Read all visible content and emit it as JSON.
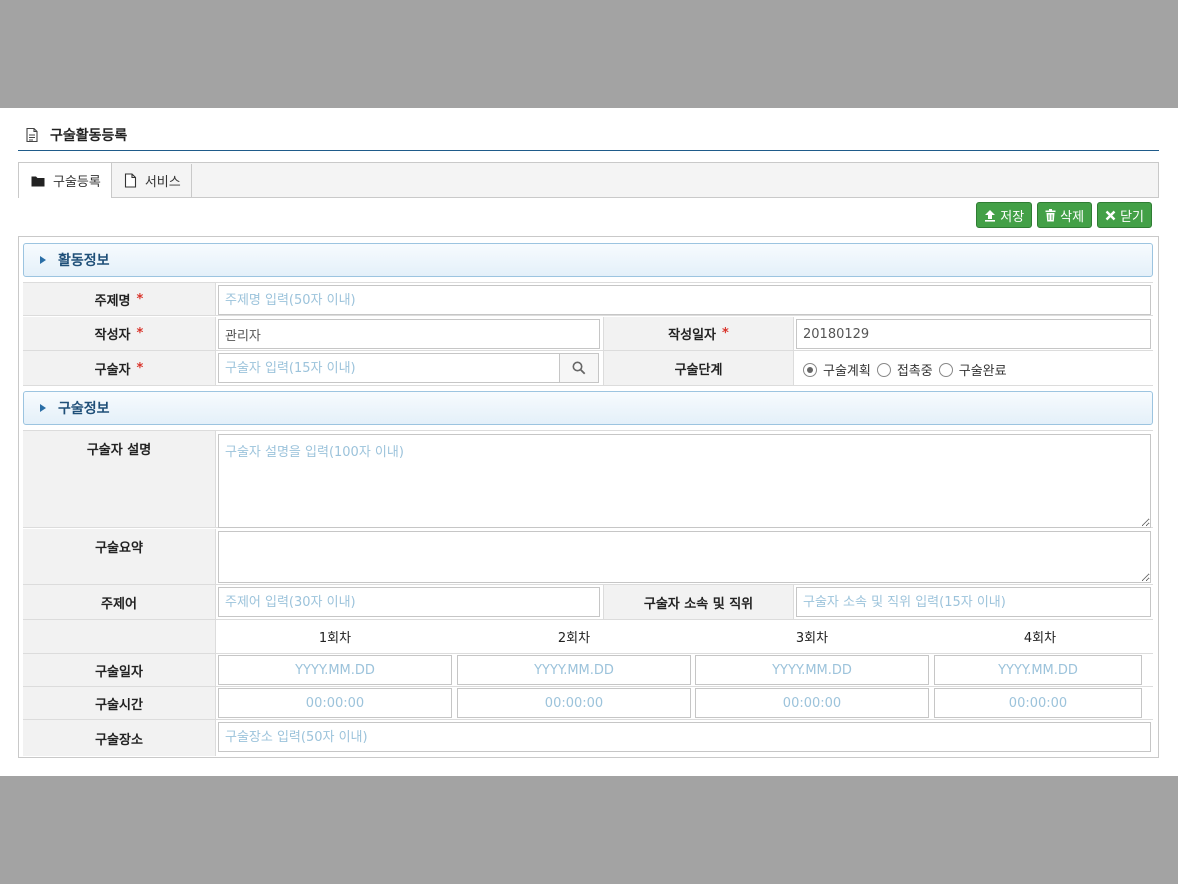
{
  "page": {
    "title": "구술활동등록"
  },
  "tabs": [
    {
      "label": "구술등록",
      "icon": "folder-icon",
      "active": true
    },
    {
      "label": "서비스",
      "icon": "document-icon",
      "active": false
    }
  ],
  "toolbar": {
    "save_label": "저장",
    "delete_label": "삭제",
    "close_label": "닫기",
    "button_color": "#43a047"
  },
  "activity_section": {
    "title": "활동정보",
    "subject_label": "주제명",
    "subject_placeholder": "주제명 입력(50자 이내)",
    "author_label": "작성자",
    "author_value": "관리자",
    "date_label": "작성일자",
    "date_value": "20180129",
    "narrator_label": "구술자",
    "narrator_placeholder": "구술자 입력(15자 이내)",
    "stage_label": "구술단계",
    "stage_options": [
      "구술계획",
      "접촉중",
      "구술완료"
    ],
    "stage_selected": "구술계획",
    "required_mark": "*"
  },
  "oral_section": {
    "title": "구술정보",
    "desc_label": "구술자 설명",
    "desc_placeholder": "구술자 설명을 입력(100자 이내)",
    "summary_label": "구술요약",
    "summary_placeholder": "",
    "keyword_label": "주제어",
    "keyword_placeholder": "주제어 입력(30자 이내)",
    "affil_label": "구술자 소속 및 직위",
    "affil_placeholder": "구술자 소속 및 직위 입력(15자 이내)",
    "sessions": [
      "1회차",
      "2회차",
      "3회차",
      "4회차"
    ],
    "oral_date_label": "구술일자",
    "date_placeholder": "YYYY.MM.DD",
    "oral_time_label": "구술시간",
    "time_placeholder": "00:00:00",
    "place_label": "구술장소",
    "place_placeholder": "구술장소 입력(50자 이내)"
  },
  "colors": {
    "accent": "#1f5b8a",
    "required": "#d9342b",
    "placeholder": "#9cc3db"
  }
}
